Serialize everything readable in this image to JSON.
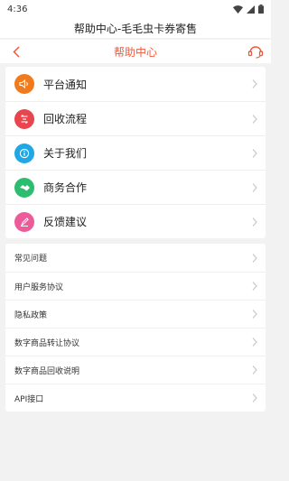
{
  "status_bar": {
    "time": "4:36"
  },
  "app_title": "帮助中心-毛毛虫卡券寄售",
  "nav": {
    "title": "帮助中心"
  },
  "primary_items": [
    {
      "label": "平台通知",
      "icon": "speaker-icon",
      "color": "#f07b1e"
    },
    {
      "label": "回收流程",
      "icon": "process-icon",
      "color": "#e8454f"
    },
    {
      "label": "关于我们",
      "icon": "info-icon",
      "color": "#1fa7e6"
    },
    {
      "label": "商务合作",
      "icon": "handshake-icon",
      "color": "#2dbd6e"
    },
    {
      "label": "反馈建议",
      "icon": "feedback-icon",
      "color": "#ee5b9b"
    }
  ],
  "secondary_items": [
    {
      "label": "常见问题"
    },
    {
      "label": "用户服务协议"
    },
    {
      "label": "隐私政策"
    },
    {
      "label": "数字商品转让协议"
    },
    {
      "label": "数字商品回收说明"
    },
    {
      "label": "API接口"
    }
  ],
  "colors": {
    "accent": "#ef5a3c",
    "background": "#f2f2f2"
  }
}
